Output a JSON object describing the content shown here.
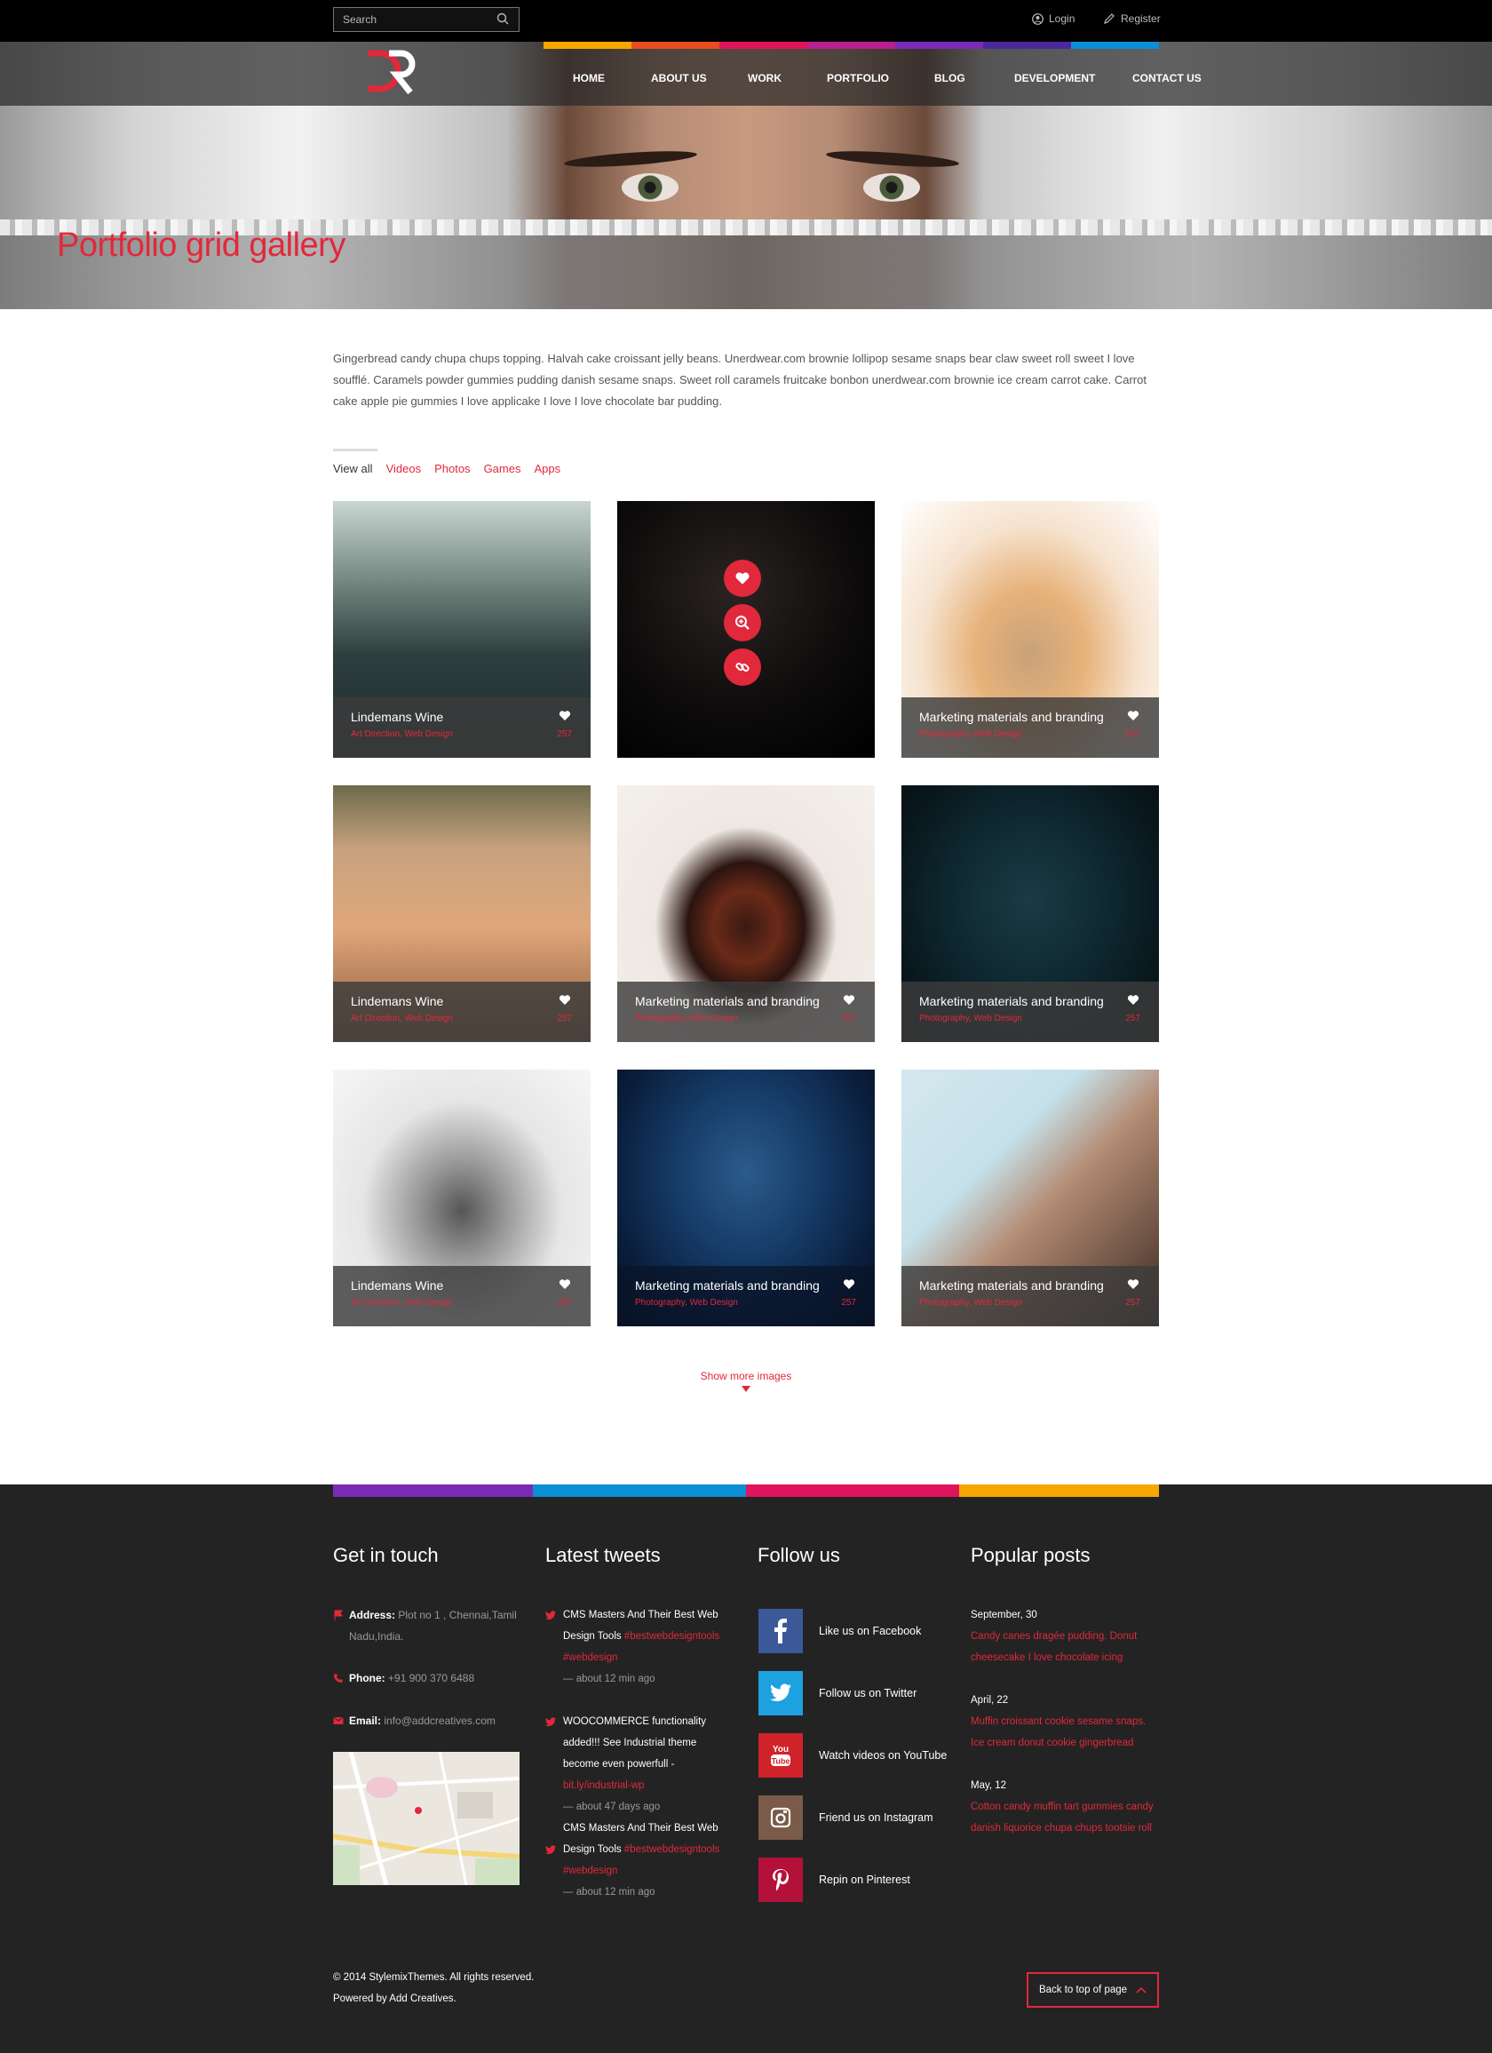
{
  "colors": {
    "accent": "#e2283b",
    "orange": "#f7a600",
    "pink": "#e0145c",
    "purple": "#7a2bb5",
    "blue": "#0b8fd6"
  },
  "header": {
    "search_placeholder": "Search",
    "login": "Login",
    "register": "Register",
    "nav": [
      "HOME",
      "ABOUT US",
      "WORK",
      "PORTFOLIO",
      "BLOG",
      "DEVELOPMENT",
      "CONTACT US"
    ],
    "logo_text": "DR"
  },
  "hero": {
    "title": "Portfolio grid gallery"
  },
  "intro": "Gingerbread candy chupa chups topping. Halvah cake croissant jelly beans. Unerdwear.com brownie lollipop sesame snaps bear claw sweet roll sweet I love soufflé. Caramels powder gummies pudding danish sesame snaps. Sweet roll caramels fruitcake bonbon unerdwear.com brownie ice cream carrot cake. Carrot cake apple pie gummies I love applicake I love I love chocolate bar pudding.",
  "filters": [
    "View all",
    "Videos",
    "Photos",
    "Games",
    "Apps"
  ],
  "grid": [
    {
      "title": "Lindemans Wine",
      "tags": "Art Direction, Web Design",
      "count": "257"
    },
    {
      "title": "",
      "tags": "",
      "count": ""
    },
    {
      "title": "Marketing materials and branding",
      "tags": "Photography, Web Design",
      "count": "257"
    },
    {
      "title": "Lindemans Wine",
      "tags": "Art Direction, Web Design",
      "count": "257"
    },
    {
      "title": "Marketing materials and branding",
      "tags": "Photography, Web Design",
      "count": "257"
    },
    {
      "title": "Marketing materials and branding",
      "tags": "Photography, Web Design",
      "count": "257"
    },
    {
      "title": "Lindemans Wine",
      "tags": "Art Direction, Web Design",
      "count": "257"
    },
    {
      "title": "Marketing materials and branding",
      "tags": "Photography, Web Design",
      "count": "257"
    },
    {
      "title": "Marketing materials and branding",
      "tags": "Photography, Web Design",
      "count": "257"
    }
  ],
  "show_more": "Show more images",
  "footer": {
    "headings": [
      "Get in touch",
      "Latest tweets",
      "Follow us",
      "Popular posts"
    ],
    "address_label": "Address:",
    "address": "Plot no 1 , Chennai,Tamil Nadu,India.",
    "phone_label": "Phone:",
    "phone": "+91 900 370 6488",
    "email_label": "Email:",
    "email": "info@addcreatives.com",
    "tweets": [
      {
        "text": "CMS Masters And Their Best Web Design Tools",
        "tag": "#bestwebdesigntools #webdesign",
        "link": "",
        "time": "— about 12 min ago"
      },
      {
        "text": "WOOCOMMERCE functionality added!!! See Industrial theme become even powerfull -",
        "tag": "",
        "link": "bit.ly/industrial-wp",
        "time": "— about 47 days ago"
      },
      {
        "text": "CMS Masters And Their Best Web Design Tools",
        "tag": "#bestwebdesigntools #webdesign",
        "link": "",
        "time": "— about 12 min ago"
      }
    ],
    "follow": [
      "Like us on Facebook",
      "Follow us on Twitter",
      "Watch videos on YouTube",
      "Friend us on Instagram",
      "Repin on Pinterest"
    ],
    "posts": [
      {
        "date": "September, 30",
        "text": "Candy canes dragée pudding. Donut cheesecake I love chocolate icing"
      },
      {
        "date": "April, 22",
        "text": "Muffin croissant cookie sesame snaps. Ice cream donut cookie gingerbread"
      },
      {
        "date": "May, 12",
        "text": "Cotton candy muffin tart gummies candy danish liquorice chupa chups tootsie roll"
      }
    ],
    "copyright": "© 2014 StylemixThemes. All rights reserved.",
    "powered": "Powered by Add Creatives.",
    "back_top": "Back to top of page"
  }
}
